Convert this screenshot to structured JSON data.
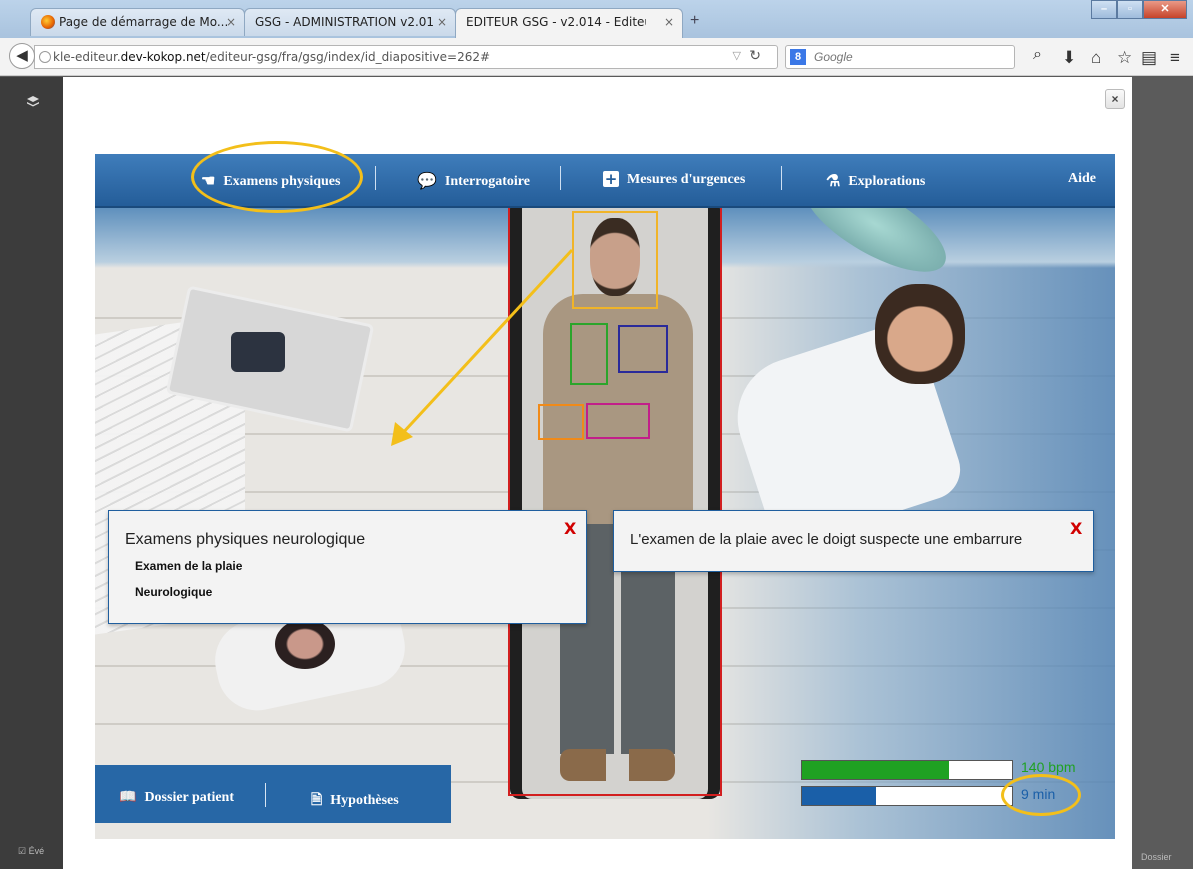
{
  "browser": {
    "tabs": [
      {
        "label": "Page de démarrage de Mo...",
        "close": "×"
      },
      {
        "label": "GSG - ADMINISTRATION v2.01...",
        "close": "×"
      },
      {
        "label": "EDITEUR GSG - v2.014 - Editeur ...",
        "close": "×"
      }
    ],
    "new_tab": "+",
    "url_domain_prefix": "kle-editeur.",
    "url_domain": "dev-kokop.net",
    "url_path": "/editeur-gsg/fra/gsg/index/id_diapositive=262#",
    "search_placeholder": "Google",
    "search_engine_letter": "8"
  },
  "modal": {
    "close": "×"
  },
  "menu": {
    "items": [
      {
        "label": "Examens physiques",
        "icon": "hand-icon"
      },
      {
        "label": "Interrogatoire",
        "icon": "speech-bubbles-icon"
      },
      {
        "label": "Mesures d'urgences",
        "icon": "medical-cross-icon"
      },
      {
        "label": "Explorations",
        "icon": "flask-icon"
      }
    ],
    "help": "Aide"
  },
  "popup_left": {
    "title": "Examens physiques neurologique",
    "close": "X",
    "items": [
      "Examen de la plaie",
      "Neurologique"
    ]
  },
  "popup_right": {
    "text": "L'examen de la plaie avec le doigt suspecte une embarrure",
    "close": "X"
  },
  "footer": {
    "items": [
      {
        "label": "Dossier patient",
        "icon": "book-icon"
      },
      {
        "label": "Hypothèses",
        "icon": "document-icon"
      }
    ]
  },
  "vitals": {
    "heart_rate_label": "140 bpm",
    "heart_rate_fill_fraction": 0.7,
    "time_label": "9 min",
    "time_fill_fraction": 0.35,
    "heart_rate_color": "#1fa122",
    "time_color": "#1a5fa8"
  },
  "annotations": {
    "highlight_color": "#f3bf1a"
  },
  "page_bottom": {
    "left_label": "Évé",
    "right_label": "Dossier"
  }
}
